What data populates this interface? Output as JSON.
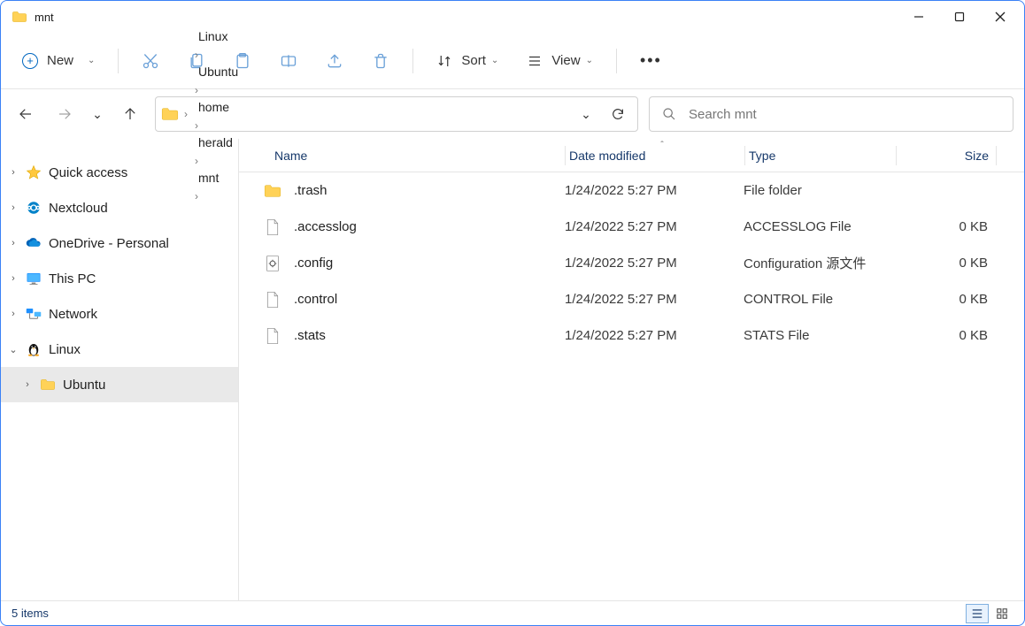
{
  "window": {
    "title": "mnt"
  },
  "toolbar": {
    "new_label": "New",
    "sort_label": "Sort",
    "view_label": "View"
  },
  "breadcrumbs": [
    "Linux",
    "Ubuntu",
    "home",
    "herald",
    "mnt"
  ],
  "search": {
    "placeholder": "Search mnt"
  },
  "sidebar": {
    "items": [
      {
        "label": "Quick access",
        "icon": "star",
        "expanded": false
      },
      {
        "label": "Nextcloud",
        "icon": "nextcloud",
        "expanded": false
      },
      {
        "label": "OneDrive - Personal",
        "icon": "onedrive",
        "expanded": false
      },
      {
        "label": "This PC",
        "icon": "monitor",
        "expanded": false
      },
      {
        "label": "Network",
        "icon": "network",
        "expanded": false
      },
      {
        "label": "Linux",
        "icon": "penguin",
        "expanded": true
      },
      {
        "label": "Ubuntu",
        "icon": "folder",
        "indent": 1,
        "selected": true
      }
    ]
  },
  "columns": {
    "name": "Name",
    "date": "Date modified",
    "type": "Type",
    "size": "Size"
  },
  "files": [
    {
      "icon": "folder",
      "name": ".trash",
      "date": "1/24/2022 5:27 PM",
      "type": "File folder",
      "size": ""
    },
    {
      "icon": "file",
      "name": ".accesslog",
      "date": "1/24/2022 5:27 PM",
      "type": "ACCESSLOG File",
      "size": "0 KB"
    },
    {
      "icon": "config",
      "name": ".config",
      "date": "1/24/2022 5:27 PM",
      "type": "Configuration 源文件",
      "size": "0 KB"
    },
    {
      "icon": "file",
      "name": ".control",
      "date": "1/24/2022 5:27 PM",
      "type": "CONTROL File",
      "size": "0 KB"
    },
    {
      "icon": "file",
      "name": ".stats",
      "date": "1/24/2022 5:27 PM",
      "type": "STATS File",
      "size": "0 KB"
    }
  ],
  "statusbar": {
    "text": "5 items"
  },
  "colors": {
    "accent": "#0067c0"
  }
}
